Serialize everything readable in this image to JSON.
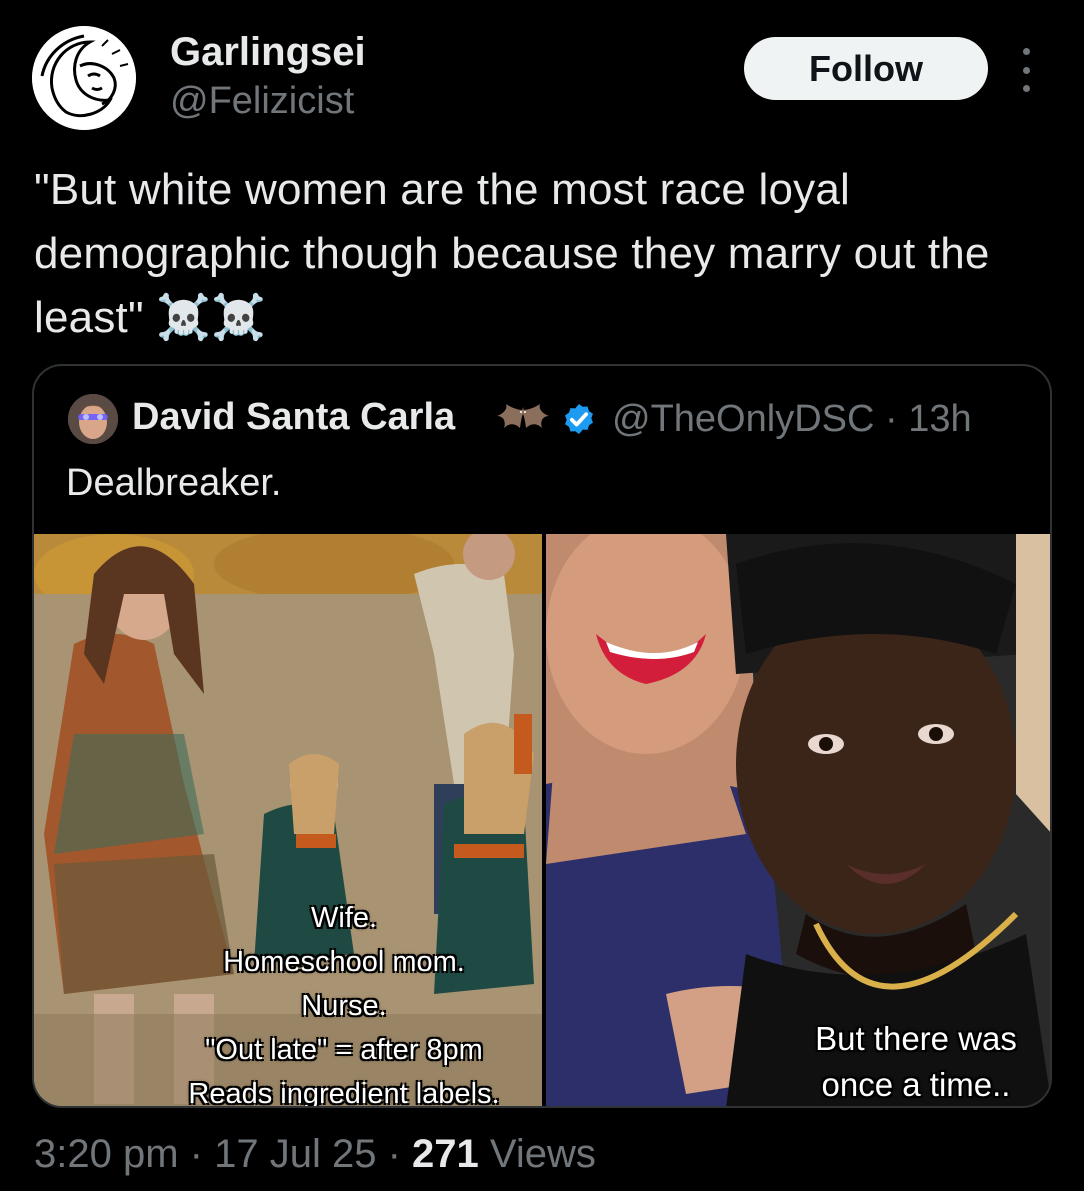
{
  "author": {
    "display_name": "Garlingsei",
    "handle": "@Felizicist"
  },
  "follow_label": "Follow",
  "tweet_text": "\"But white women are the most race loyal demographic though because they marry out the least\" ☠️☠️",
  "quote": {
    "display_name": "David Santa Carla",
    "handle": "@TheOnlyDSC",
    "separator": "·",
    "time_ago": "13h",
    "text": "Dealbreaker.",
    "left_caption": [
      "Wife.",
      "Homeschool mom.",
      "Nurse.",
      "\"Out late\" = after 8pm",
      "Reads ingredient labels."
    ],
    "right_caption": [
      "But there was",
      "once a time.."
    ]
  },
  "footer": {
    "time": "3:20 pm",
    "date": "17 Jul 25",
    "views_count": "271",
    "views_label": "Views",
    "separator": "·"
  },
  "colors": {
    "background": "#000000",
    "text_primary": "#e7e9ea",
    "text_secondary": "#71767b",
    "verified_blue": "#1d9bf0",
    "border": "#2f3336"
  }
}
